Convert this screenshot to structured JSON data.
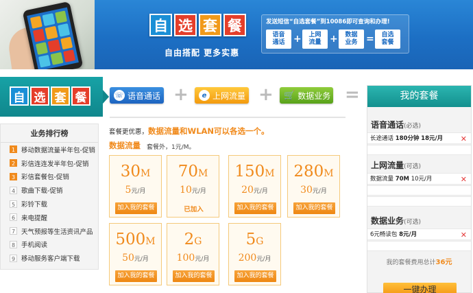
{
  "banner": {
    "logo_chars": [
      "自",
      "选",
      "套",
      "餐"
    ],
    "logo_colors": [
      "#1a8fd6",
      "#e53e2a",
      "#f19a1a",
      "#e53e2a"
    ],
    "slogan": "自由搭配  更多实惠",
    "promo_text": "发送短信“自选套餐”到10086即可查询和办理!",
    "formula": [
      {
        "label": "语音\n通话"
      },
      {
        "op": "+"
      },
      {
        "label": "上网\n流量"
      },
      {
        "op": "+"
      },
      {
        "label": "数据\n业务"
      },
      {
        "op": "="
      },
      {
        "label": "自选\n套餐"
      }
    ]
  },
  "nav": {
    "logo_chars": [
      "自",
      "选",
      "套",
      "餐"
    ],
    "logo_colors": [
      "#1a8fd6",
      "#e53e2a",
      "#f19a1a",
      "#e53e2a"
    ],
    "voice_label": "语音通话",
    "data_label": "上网流量",
    "biz_label": "数据业务",
    "voice_icon_glyph": "☏",
    "data_icon_glyph": "e",
    "cart_icon_glyph": "🛒",
    "plus": "+",
    "equals": "="
  },
  "ranking": {
    "title": "业务排行榜",
    "items": [
      {
        "num": "1",
        "label": "移动数据流量半年包-促销"
      },
      {
        "num": "2",
        "label": "彩信连连发半年包-促销"
      },
      {
        "num": "3",
        "label": "彩信套餐包-促销"
      },
      {
        "num": "4",
        "label": "歌曲下载-促销"
      },
      {
        "num": "5",
        "label": "彩铃下载"
      },
      {
        "num": "6",
        "label": "来电提醒"
      },
      {
        "num": "7",
        "label": "天气预报等生活资讯产品"
      },
      {
        "num": "8",
        "label": "手机阅读"
      },
      {
        "num": "9",
        "label": "移动服务客户端下载"
      }
    ]
  },
  "content": {
    "desc_prefix": "套餐更优惠，",
    "desc_highlight": "数据流量和WLAN可以各选一个。",
    "section_title": "数据流量",
    "section_note": "套餐外，1元/M。",
    "cards": [
      {
        "size": "30",
        "unit": "M",
        "price": "5",
        "price_unit": "元/月",
        "button": "加入我的套餐",
        "added": false
      },
      {
        "size": "70",
        "unit": "M",
        "price": "10",
        "price_unit": "元/月",
        "button": "已加入",
        "added": true
      },
      {
        "size": "150",
        "unit": "M",
        "price": "20",
        "price_unit": "元/月",
        "button": "加入我的套餐",
        "added": false
      },
      {
        "size": "280",
        "unit": "M",
        "price": "30",
        "price_unit": "元/月",
        "button": "加入我的套餐",
        "added": false
      },
      {
        "size": "500",
        "unit": "M",
        "price": "50",
        "price_unit": "元/月",
        "button": "加入我的套餐",
        "added": false
      },
      {
        "size": "2",
        "unit": "G",
        "price": "100",
        "price_unit": "元/月",
        "button": "加入我的套餐",
        "added": false
      },
      {
        "size": "5",
        "unit": "G",
        "price": "200",
        "price_unit": "元/月",
        "button": "加入我的套餐",
        "added": false
      }
    ]
  },
  "panel": {
    "title": "我的套餐",
    "voice": {
      "title": "语音通话",
      "tag": "(必选)",
      "item_name": "长途通话",
      "item_value": "180分钟",
      "item_price": "18元/月"
    },
    "data": {
      "title": "上网流量",
      "tag": "(可选)",
      "item_name": "数据流量",
      "item_value": "70M",
      "item_price": "10元/月"
    },
    "biz": {
      "title": "数据业务",
      "tag": "(可选)",
      "item_name": "6元畅读包",
      "item_price": "8元/月"
    },
    "delete_glyph": "✕",
    "total_prefix": "我的套餐费用总计",
    "total_value": "36元",
    "submit": "一键办理"
  }
}
